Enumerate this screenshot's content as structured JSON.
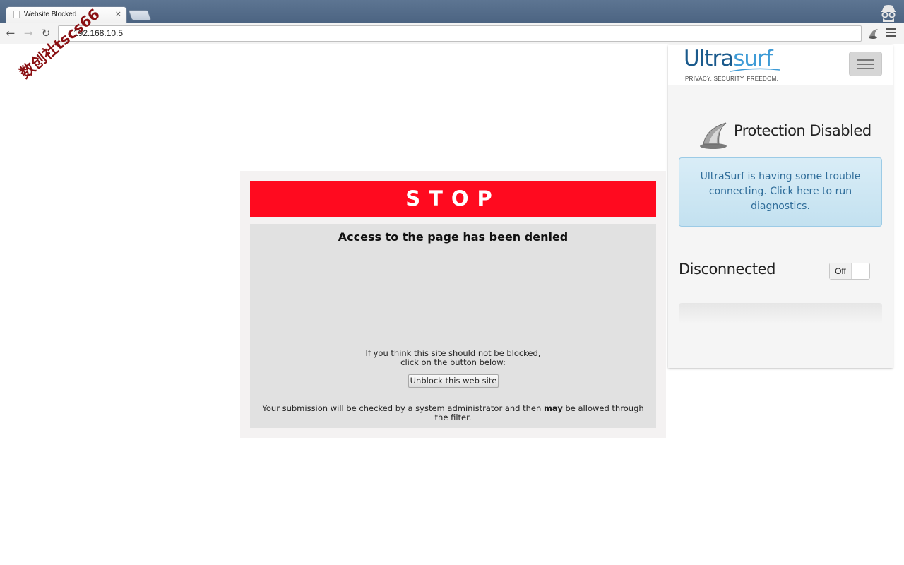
{
  "browser": {
    "tab_title": "Website Blocked",
    "tab_close": "×",
    "url": "192.168.10.5",
    "nav": {
      "back": "←",
      "forward": "→",
      "reload": "↻"
    },
    "icons": [
      "page-icon",
      "incognito-icon",
      "ultrasurf-extension-icon",
      "menu-icon"
    ]
  },
  "watermark": {
    "text": "数创社tscs66"
  },
  "block_page": {
    "stop_label": "STOP",
    "heading": "Access to the page has been denied",
    "think_line1": "If you think this site should not be blocked,",
    "think_line2": "click on the button below:",
    "unblock_button": "Unblock this web site",
    "submission_pre": "Your submission will be checked by a system administrator and then ",
    "submission_bold": "may",
    "submission_post": " be allowed through the filter.",
    "colors": {
      "stop": "#ff0a1f",
      "panel": "#e1e1e1"
    }
  },
  "ultrasurf": {
    "logo_ultra": "Ultra",
    "logo_surf": "surf",
    "tagline": "PRIVACY. SECURITY. FREEDOM.",
    "protection_status": "Protection Disabled",
    "alert_text": "UltraSurf is having some trouble connecting. Click here to run diagnostics.",
    "connection_status": "Disconnected",
    "toggle_label": "Off",
    "colors": {
      "brand_dark": "#1a5a8c",
      "brand_light": "#3e9bd6",
      "alert_text": "#2f6d9a"
    }
  }
}
